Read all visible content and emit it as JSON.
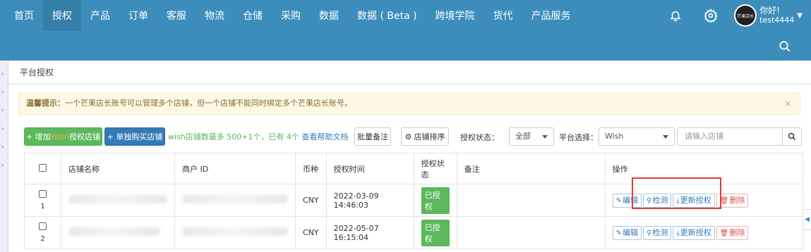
{
  "nav": {
    "items": [
      "首页",
      "授权",
      "产品",
      "订单",
      "客服",
      "物流",
      "仓储",
      "采购",
      "数据",
      "数据 ( Beta )",
      "跨境学院",
      "货代",
      "产品服务"
    ],
    "active_index": 1,
    "user": {
      "avatar_text": "芒果店长",
      "greeting": "你好!",
      "username": "test4444"
    }
  },
  "icons": {
    "bell": "bell-icon",
    "settings": "gear-icon",
    "search": "search-icon",
    "caret": "chevron-down-icon"
  },
  "breadcrumb": "平台授权",
  "alert": {
    "title": "温馨提示：",
    "text": "一个芒果店长账号可以管理多个店铺，但一个店铺不能同时绑定多个芒果店长账号。",
    "close": "×"
  },
  "toolbar": {
    "add_prefix": "+ 增加",
    "add_wish": "Wish",
    "add_suffix": "授权店铺",
    "buy_label": "+ 单独购买店铺",
    "limit_text": "wish店铺数最多 500+1个，已有 4个",
    "help_link": "查看帮助文档",
    "batch_note": "批量备注",
    "sort_label": "店铺排序",
    "status_label": "授权状态：",
    "status_value": "全部",
    "platform_label": "平台选择：",
    "platform_value": "Wish",
    "search_placeholder": "请输入店铺"
  },
  "table": {
    "headers": [
      "店铺名称",
      "商户 ID",
      "币种",
      "授权时间",
      "授权状态",
      "备注",
      "操作"
    ],
    "rows": [
      {
        "num": "1",
        "currency": "CNY",
        "time": "2022-03-09 14:46:03",
        "status": "已授权"
      },
      {
        "num": "2",
        "currency": "CNY",
        "time": "2022-05-07 16:15:04",
        "status": "已授权"
      }
    ],
    "actions": {
      "edit": "编辑",
      "check": "检测",
      "reauth": "更新授权",
      "delete": "删除"
    }
  },
  "colors": {
    "nav_bg": "#3c8dbc",
    "highlight": "#e53935",
    "badge": "#5cb85c"
  }
}
